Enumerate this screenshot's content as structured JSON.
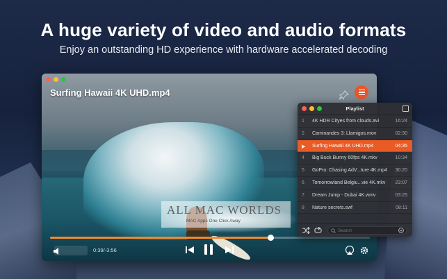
{
  "marketing": {
    "headline": "A huge variety of video and audio formats",
    "subline": "Enjoy an outstanding HD experience with hardware accelerated decoding"
  },
  "player": {
    "video_title": "Surfing Hawaii 4K UHD.mp4",
    "time_display": "0:39/-3:56",
    "progress_fraction": 0.69,
    "accent_color": "#f28a2e",
    "icons": {
      "pin": "pin-icon",
      "menu": "hamburger-menu-icon",
      "volume": "volume-icon",
      "previous": "skip-previous-icon",
      "pause": "pause-icon",
      "next": "skip-next-icon",
      "airplay": "airplay-icon",
      "settings": "gear-icon"
    }
  },
  "playlist": {
    "title": "Playlist",
    "active_color": "#ea5a24",
    "items": [
      {
        "num": "1",
        "name": "4K HDR Cityes from clouds.avi",
        "duration": "16:24",
        "active": false
      },
      {
        "num": "2",
        "name": "Caminandes 3: Llamigos.mov",
        "duration": "02:30",
        "active": false
      },
      {
        "num": "▶",
        "name": "Surfing Hawaii 4K UHD.mp4",
        "duration": "04:35",
        "active": true
      },
      {
        "num": "4",
        "name": "Big Buck Bunny 60fps 4K.mkv",
        "duration": "10:34",
        "active": false
      },
      {
        "num": "5",
        "name": "GoPro: Chasing AdV...ture 4K.mp4",
        "duration": "30:20",
        "active": false
      },
      {
        "num": "6",
        "name": "Tomorrowland Belgiu...vie 4K.mkv",
        "duration": "23:07",
        "active": false
      },
      {
        "num": "7",
        "name": "Dream Jump - Dubai 4K.wmv",
        "duration": "03:25",
        "active": false
      },
      {
        "num": "8",
        "name": "Nature secrets.swf",
        "duration": "08:11",
        "active": false
      }
    ],
    "search_placeholder": "Search",
    "icons": {
      "shuffle": "shuffle-icon",
      "repeat": "repeat-icon",
      "search": "search-icon",
      "add": "add-circle-icon"
    }
  },
  "watermark": {
    "main": "ALL MAC WORLDS",
    "sub": "MAC Apps One Click Away"
  }
}
